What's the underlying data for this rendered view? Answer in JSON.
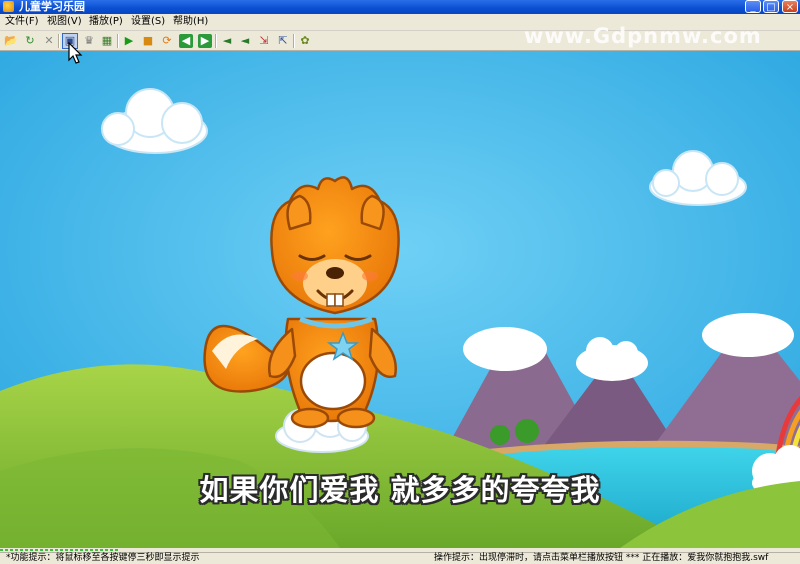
{
  "window": {
    "title": "儿童学习乐园",
    "controls": {
      "minimize": "_",
      "maximize": "□",
      "close": "×"
    }
  },
  "menu": [
    {
      "label": "文件(F)"
    },
    {
      "label": "视图(V)"
    },
    {
      "label": "播放(P)"
    },
    {
      "label": "设置(S)"
    },
    {
      "label": "帮助(H)"
    }
  ],
  "toolbar": {
    "buttons": [
      {
        "icon": "open-folder-icon",
        "glyph": "📂"
      },
      {
        "icon": "refresh-icon",
        "glyph": "↻"
      },
      {
        "icon": "delete-icon",
        "glyph": "✕"
      },
      {
        "icon": "screen-icon",
        "glyph": "▣"
      },
      {
        "icon": "trophy-icon",
        "glyph": "♛"
      },
      {
        "icon": "image-icon",
        "glyph": "▦"
      },
      {
        "icon": "play-icon",
        "glyph": "▶"
      },
      {
        "icon": "stop-icon",
        "glyph": "■"
      },
      {
        "icon": "loop-icon",
        "glyph": "⟳"
      },
      {
        "icon": "previous-icon",
        "glyph": "◀"
      },
      {
        "icon": "next-icon",
        "glyph": "▶"
      },
      {
        "icon": "volume-down-icon",
        "glyph": "◄"
      },
      {
        "icon": "volume-up-icon",
        "glyph": "◄"
      },
      {
        "icon": "exit-fullscreen-icon",
        "glyph": "⇲"
      },
      {
        "icon": "fullscreen-icon",
        "glyph": "⇱"
      },
      {
        "icon": "settings-icon",
        "glyph": "✿"
      }
    ]
  },
  "watermark": "www.Gdpnmw.com",
  "video": {
    "subtitle": "如果你们爱我 就多多的夸夸我",
    "progress": 0.15
  },
  "status": {
    "left": "*功能提示：将鼠标移至各按键停三秒即显示提示",
    "right": "操作提示：出现停滞时，请点击菜单栏播放按钮 *** 正在播放：爱我你就抱抱我.swf"
  },
  "colors": {
    "sky": "#41b6ea",
    "titlebar": "#0a4fd0",
    "squirrel": "#f28c16",
    "hill": "#8cc43c",
    "subtitle_outline": "#2b2b2b"
  }
}
